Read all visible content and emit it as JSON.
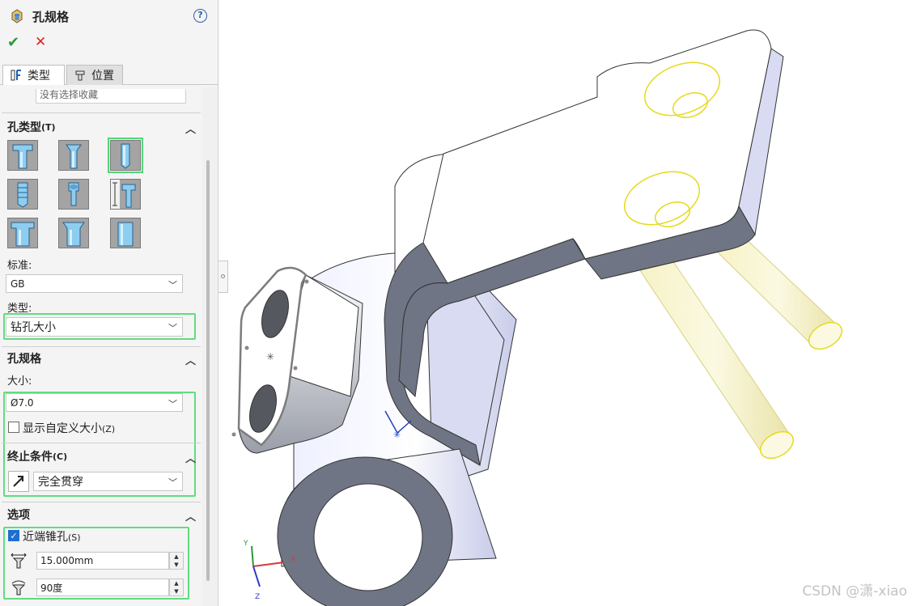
{
  "panel": {
    "title": "孔规格",
    "help": "?",
    "ok": "✔",
    "cancel": "✕",
    "tabs": [
      {
        "label": "类型"
      },
      {
        "label": "位置"
      }
    ],
    "partial_field": "没有选择收藏"
  },
  "hole_type": {
    "header": "孔类型",
    "header_key": "(T)",
    "selected_index": 2
  },
  "standard": {
    "label": "标准:",
    "value": "GB"
  },
  "type": {
    "label": "类型:",
    "value": "钻孔大小"
  },
  "hole_spec": {
    "header": "孔规格",
    "size_label": "大小:",
    "size_value": "Ø7.0",
    "custom_size_label": "显示自定义大小",
    "custom_size_key": "(Z)"
  },
  "end_condition": {
    "header": "终止条件",
    "header_key": "(C)",
    "value": "完全贯穿"
  },
  "options": {
    "header": "选项",
    "near_side_csk_label": "近端锥孔",
    "near_side_csk_key": "(S)",
    "near_side_csk_checked": true,
    "diameter_value": "15.000mm",
    "angle_value": "90度"
  },
  "viewport": {
    "triad": {
      "x": "X",
      "y": "Y",
      "z": "Z"
    },
    "watermark": "CSDN @潇-xiao"
  },
  "colors": {
    "selection_green": "#61dc7e",
    "preview_yellow": "#f5f0b0",
    "model_side": "#d9dbf2",
    "model_dark": "#6f7584"
  }
}
